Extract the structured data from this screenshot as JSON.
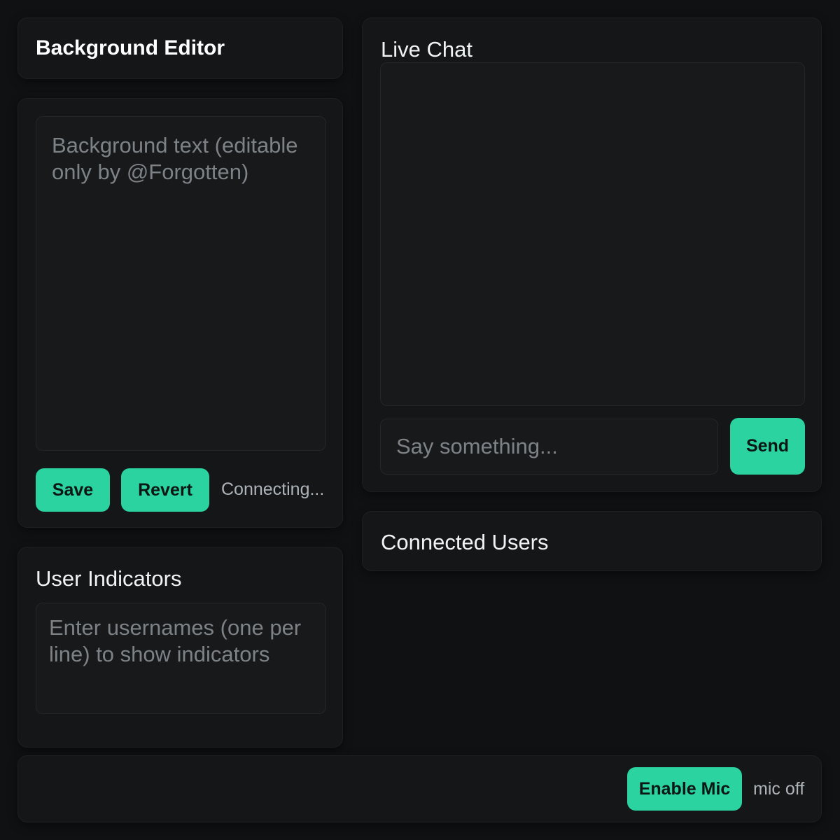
{
  "background_editor": {
    "title": "Background Editor",
    "textarea_placeholder": "Background text (editable only by @Forgotten)",
    "textarea_value": "",
    "save_label": "Save",
    "revert_label": "Revert",
    "status": "Connecting..."
  },
  "user_indicators": {
    "title": "User Indicators",
    "textarea_placeholder": "Enter usernames (one per line) to show indicators",
    "textarea_value": ""
  },
  "live_chat": {
    "title": "Live Chat",
    "input_placeholder": "Say something...",
    "input_value": "",
    "send_label": "Send"
  },
  "connected_users": {
    "title": "Connected Users"
  },
  "mic": {
    "enable_label": "Enable Mic",
    "status": "mic off"
  },
  "colors": {
    "accent": "#2bd3a1",
    "background": "#0f1113",
    "card": "#141618"
  }
}
